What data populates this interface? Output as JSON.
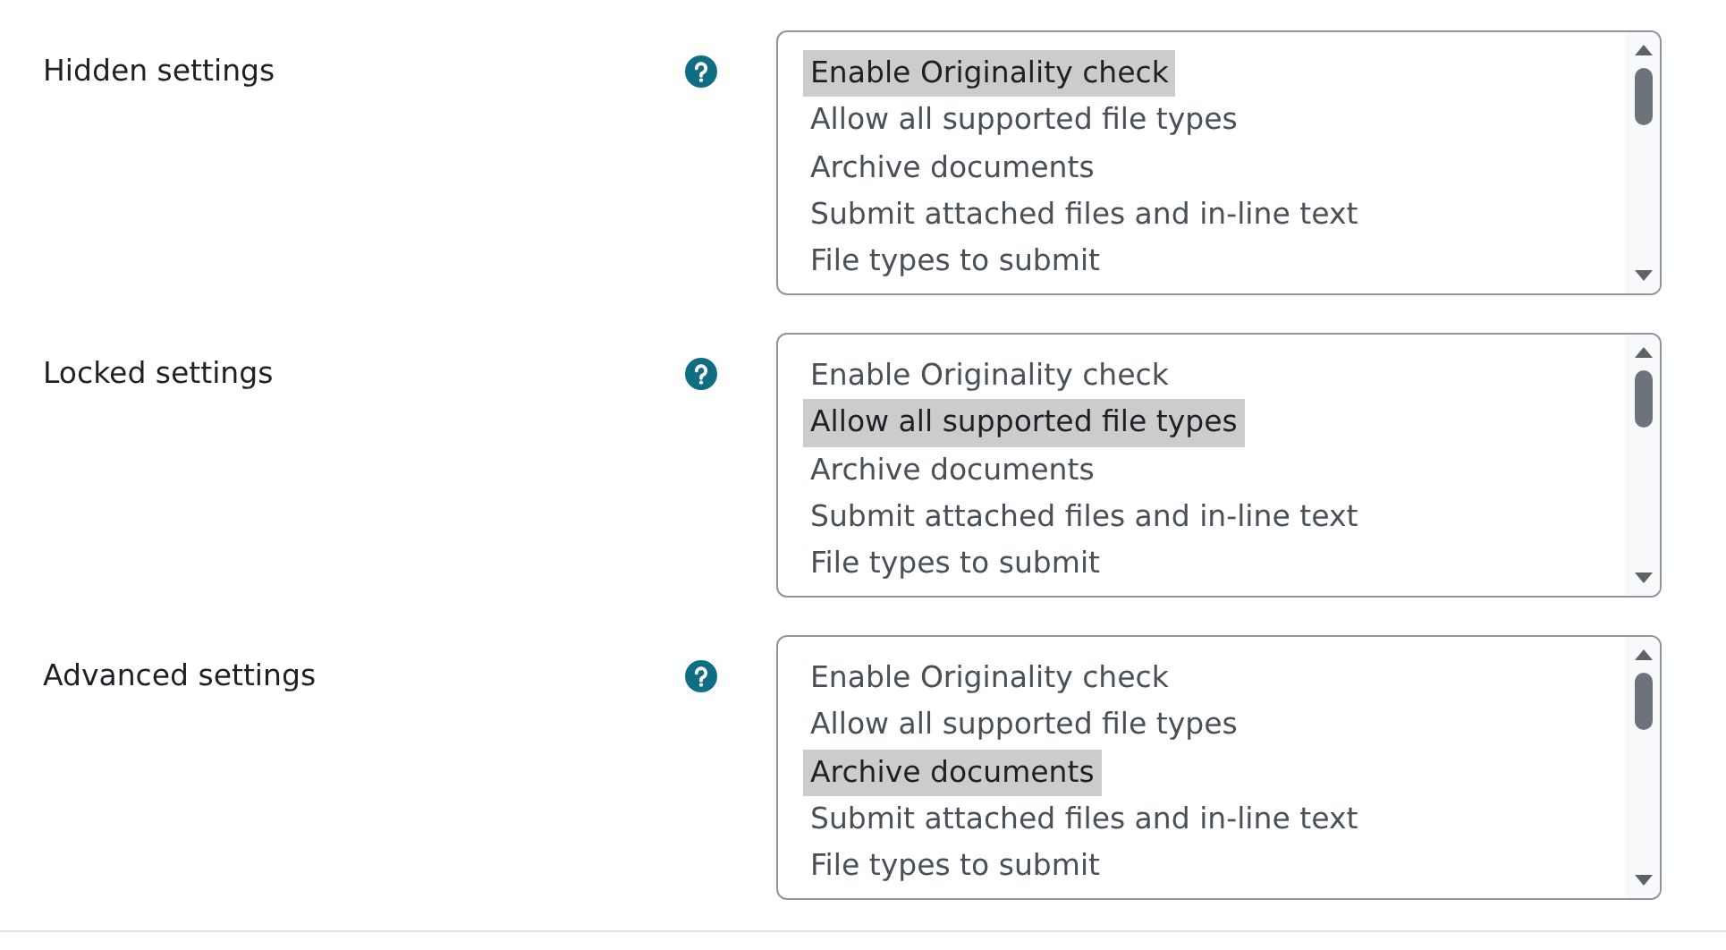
{
  "settings": [
    {
      "label": "Hidden settings",
      "options": [
        {
          "text": "Enable Originality check",
          "selected": true
        },
        {
          "text": "Allow all supported file types",
          "selected": false
        },
        {
          "text": "Archive documents",
          "selected": false
        },
        {
          "text": "Submit attached files and in-line text",
          "selected": false
        },
        {
          "text": "File types to submit",
          "selected": false
        }
      ]
    },
    {
      "label": "Locked settings",
      "options": [
        {
          "text": "Enable Originality check",
          "selected": false
        },
        {
          "text": "Allow all supported file types",
          "selected": true
        },
        {
          "text": "Archive documents",
          "selected": false
        },
        {
          "text": "Submit attached files and in-line text",
          "selected": false
        },
        {
          "text": "File types to submit",
          "selected": false
        }
      ]
    },
    {
      "label": "Advanced settings",
      "options": [
        {
          "text": "Enable Originality check",
          "selected": false
        },
        {
          "text": "Allow all supported file types",
          "selected": false
        },
        {
          "text": "Archive documents",
          "selected": true
        },
        {
          "text": "Submit attached files and in-line text",
          "selected": false
        },
        {
          "text": "File types to submit",
          "selected": false
        }
      ]
    }
  ]
}
